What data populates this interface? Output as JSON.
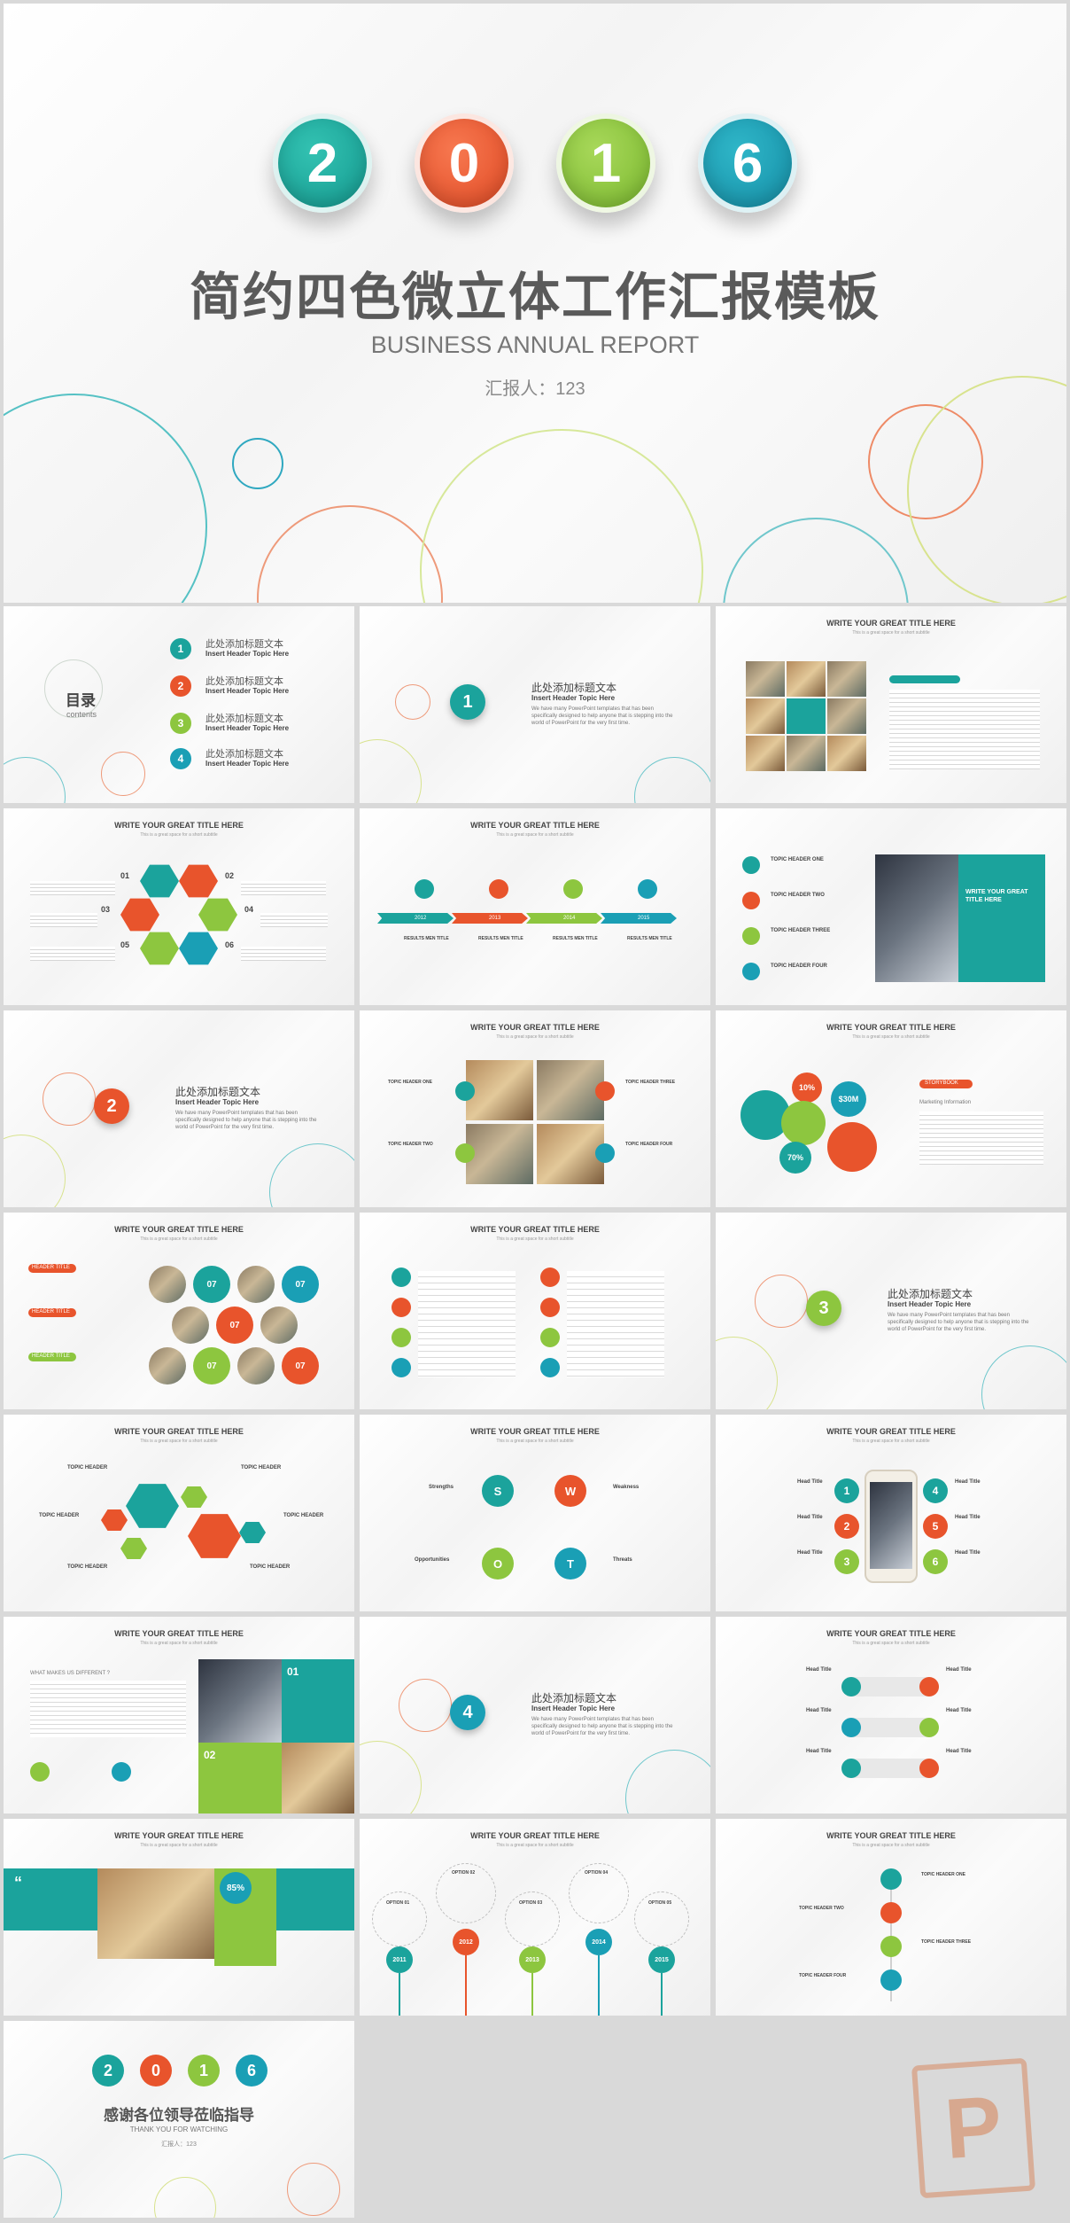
{
  "cover": {
    "year_digits": [
      "2",
      "0",
      "1",
      "6"
    ],
    "title": "简约四色微立体工作汇报模板",
    "subtitle": "BUSINESS ANNUAL REPORT",
    "reporter": "汇报人：123"
  },
  "colors": {
    "teal": "#1ba39c",
    "orange": "#e8542c",
    "green": "#8dc63f",
    "cyan": "#1a9fb5"
  },
  "common": {
    "title": "WRITE YOUR GREAT TITLE HERE",
    "subtitle": "This is a great space for a short subtitle"
  },
  "toc": {
    "heading": "目录",
    "heading_en": "contents",
    "items": [
      {
        "num": "1",
        "cn": "此处添加标题文本",
        "en": "Insert Header Topic Here"
      },
      {
        "num": "2",
        "cn": "此处添加标题文本",
        "en": "Insert Header Topic Here"
      },
      {
        "num": "3",
        "cn": "此处添加标题文本",
        "en": "Insert Header Topic Here"
      },
      {
        "num": "4",
        "cn": "此处添加标题文本",
        "en": "Insert Header Topic Here"
      }
    ]
  },
  "section": {
    "cn": "此处添加标题文本",
    "en": "Insert Header Topic Here",
    "body": "We have many PowerPoint templates that has been specifically designed to help anyone that is stepping into the world of PowerPoint for the very first time.",
    "numbers": [
      "1",
      "2",
      "3",
      "4"
    ]
  },
  "timeline": {
    "years": [
      "2012",
      "2013",
      "2014",
      "2015"
    ],
    "label": "RESULTS MEN TITLE"
  },
  "topics": [
    "TOPIC HEADER ONE",
    "TOPIC HEADER TWO",
    "TOPIC HEADER THREE",
    "TOPIC HEADER FOUR"
  ],
  "write_title_box": "WRITE YOUR GREAT TITLE HERE",
  "hex_numbers": [
    "01",
    "02",
    "03",
    "04",
    "05",
    "06"
  ],
  "stats": {
    "values": [
      "10%",
      "$30M",
      "70%"
    ],
    "label": "STORYBOOK",
    "sub": "Marketing Information"
  },
  "employees": {
    "label": "HEADER TITLE",
    "counts": [
      "07",
      "07",
      "07",
      "07",
      "07",
      "07"
    ],
    "unit": "EMPLOYEES"
  },
  "swot": {
    "letters": [
      "S",
      "W",
      "O",
      "T"
    ],
    "labels": [
      "Strengths",
      "Weakness",
      "Opportunities",
      "Threats"
    ]
  },
  "head_title": "Head Title",
  "numbers_six": [
    "1",
    "2",
    "3",
    "4",
    "5",
    "6"
  ],
  "diff": {
    "question": "WHAT MAKES US DIFFERENT ?",
    "items": [
      "01",
      "02"
    ]
  },
  "quote": {
    "percent": "85%"
  },
  "options": {
    "labels": [
      "OPTION 01",
      "OPTION 02",
      "OPTION 03",
      "OPTION 04",
      "OPTION 05"
    ],
    "years": [
      "2011",
      "2012",
      "2013",
      "2014",
      "2015"
    ]
  },
  "ending": {
    "year_digits": [
      "2",
      "0",
      "1",
      "6"
    ],
    "title": "感谢各位领导莅临指导",
    "subtitle": "THANK YOU FOR WATCHING",
    "reporter": "汇报人：123"
  }
}
